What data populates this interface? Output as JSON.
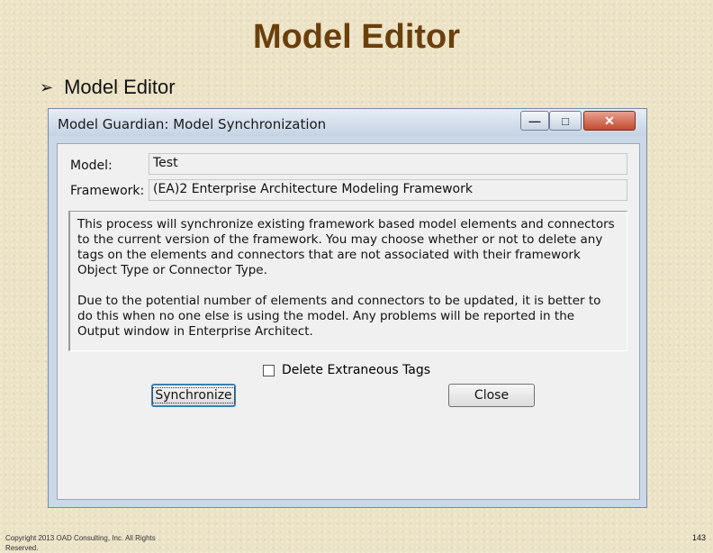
{
  "slide": {
    "title": "Model Editor",
    "bullet": "Model Editor",
    "footer_copyright": "Copyright 2013 OAD Consulting, Inc. All Rights Reserved.",
    "page_number": "143"
  },
  "window": {
    "title": "Model Guardian: Model Synchronization",
    "controls": {
      "minimize": "—",
      "maximize": "□",
      "close": "✕"
    }
  },
  "form": {
    "model_label": "Model:",
    "model_value": "Test",
    "framework_label": "Framework:",
    "framework_value": "(EA)2 Enterprise Architecture Modeling Framework",
    "description_p1": "This process will synchronize existing framework based model elements and connectors to the current version of the framework. You may choose whether or not to delete any tags on the elements and connectors that are not associated with their framework Object Type or Connector Type.",
    "description_p2": "Due to the potential number of elements and connectors to be updated, it is better to do this when no one else is using the model. Any problems will be reported in the Output window in Enterprise Architect.",
    "checkbox_label": "Delete Extraneous Tags",
    "checkbox_checked": false,
    "synchronize_button": "Synchronize",
    "close_button": "Close"
  },
  "colors": {
    "title_color": "#6b3f0c",
    "background": "#ece3c6",
    "close_button_red": "#c24b30"
  }
}
